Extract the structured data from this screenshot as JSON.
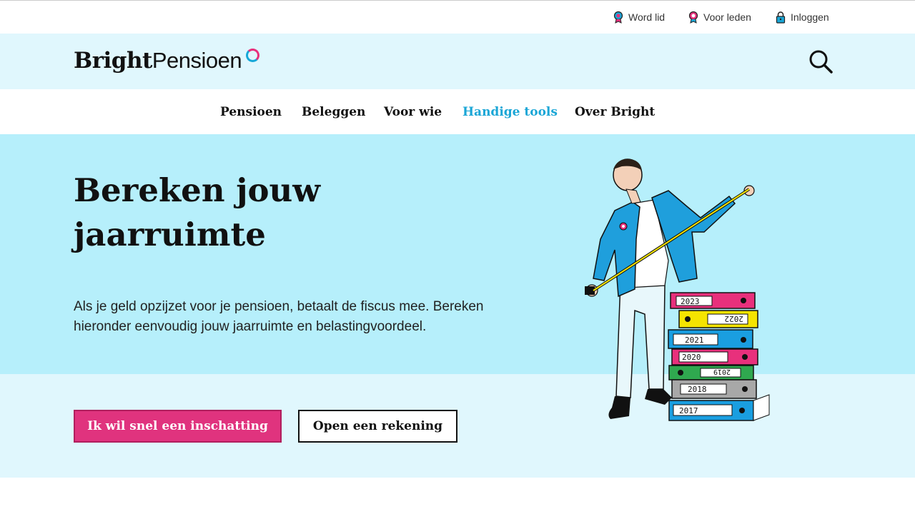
{
  "utility_nav": {
    "word_lid": "Word lid",
    "voor_leden": "Voor leden",
    "inloggen": "Inloggen"
  },
  "brand": {
    "part1": "Bright",
    "part2": "Pensioen"
  },
  "main_nav": {
    "items": [
      {
        "label": "Pensioen"
      },
      {
        "label": "Beleggen"
      },
      {
        "label": "Voor wie"
      },
      {
        "label": "Handige tools"
      },
      {
        "label": "Over Bright"
      }
    ],
    "active": "Handige tools"
  },
  "hero": {
    "title_line1": "Bereken jouw",
    "title_line2": "jaarruimte",
    "intro": "Als je geld opzijzet voor je pensioen, betaalt de fiscus mee. Bereken hieronder eenvoudig jouw jaarruimte en belastingvoordeel.",
    "primary_button": "Ik wil snel een inschatting",
    "secondary_button": "Open een rekening"
  },
  "illustration": {
    "binders": [
      {
        "year": "2023",
        "color": "#e8307c"
      },
      {
        "year": "2022",
        "color": "#f5e400"
      },
      {
        "year": "2021",
        "color": "#1a9ee0"
      },
      {
        "year": "2020",
        "color": "#e8307c"
      },
      {
        "year": "2019",
        "color": "#2fa84f"
      },
      {
        "year": "2018",
        "color": "#a8a8a8"
      },
      {
        "year": "2017",
        "color": "#1a9ee0"
      }
    ]
  },
  "colors": {
    "accent_pink": "#e0337e",
    "accent_blue": "#1aa6d6",
    "hero_bg": "#b6effb",
    "light_bg": "#e0f7fd"
  }
}
